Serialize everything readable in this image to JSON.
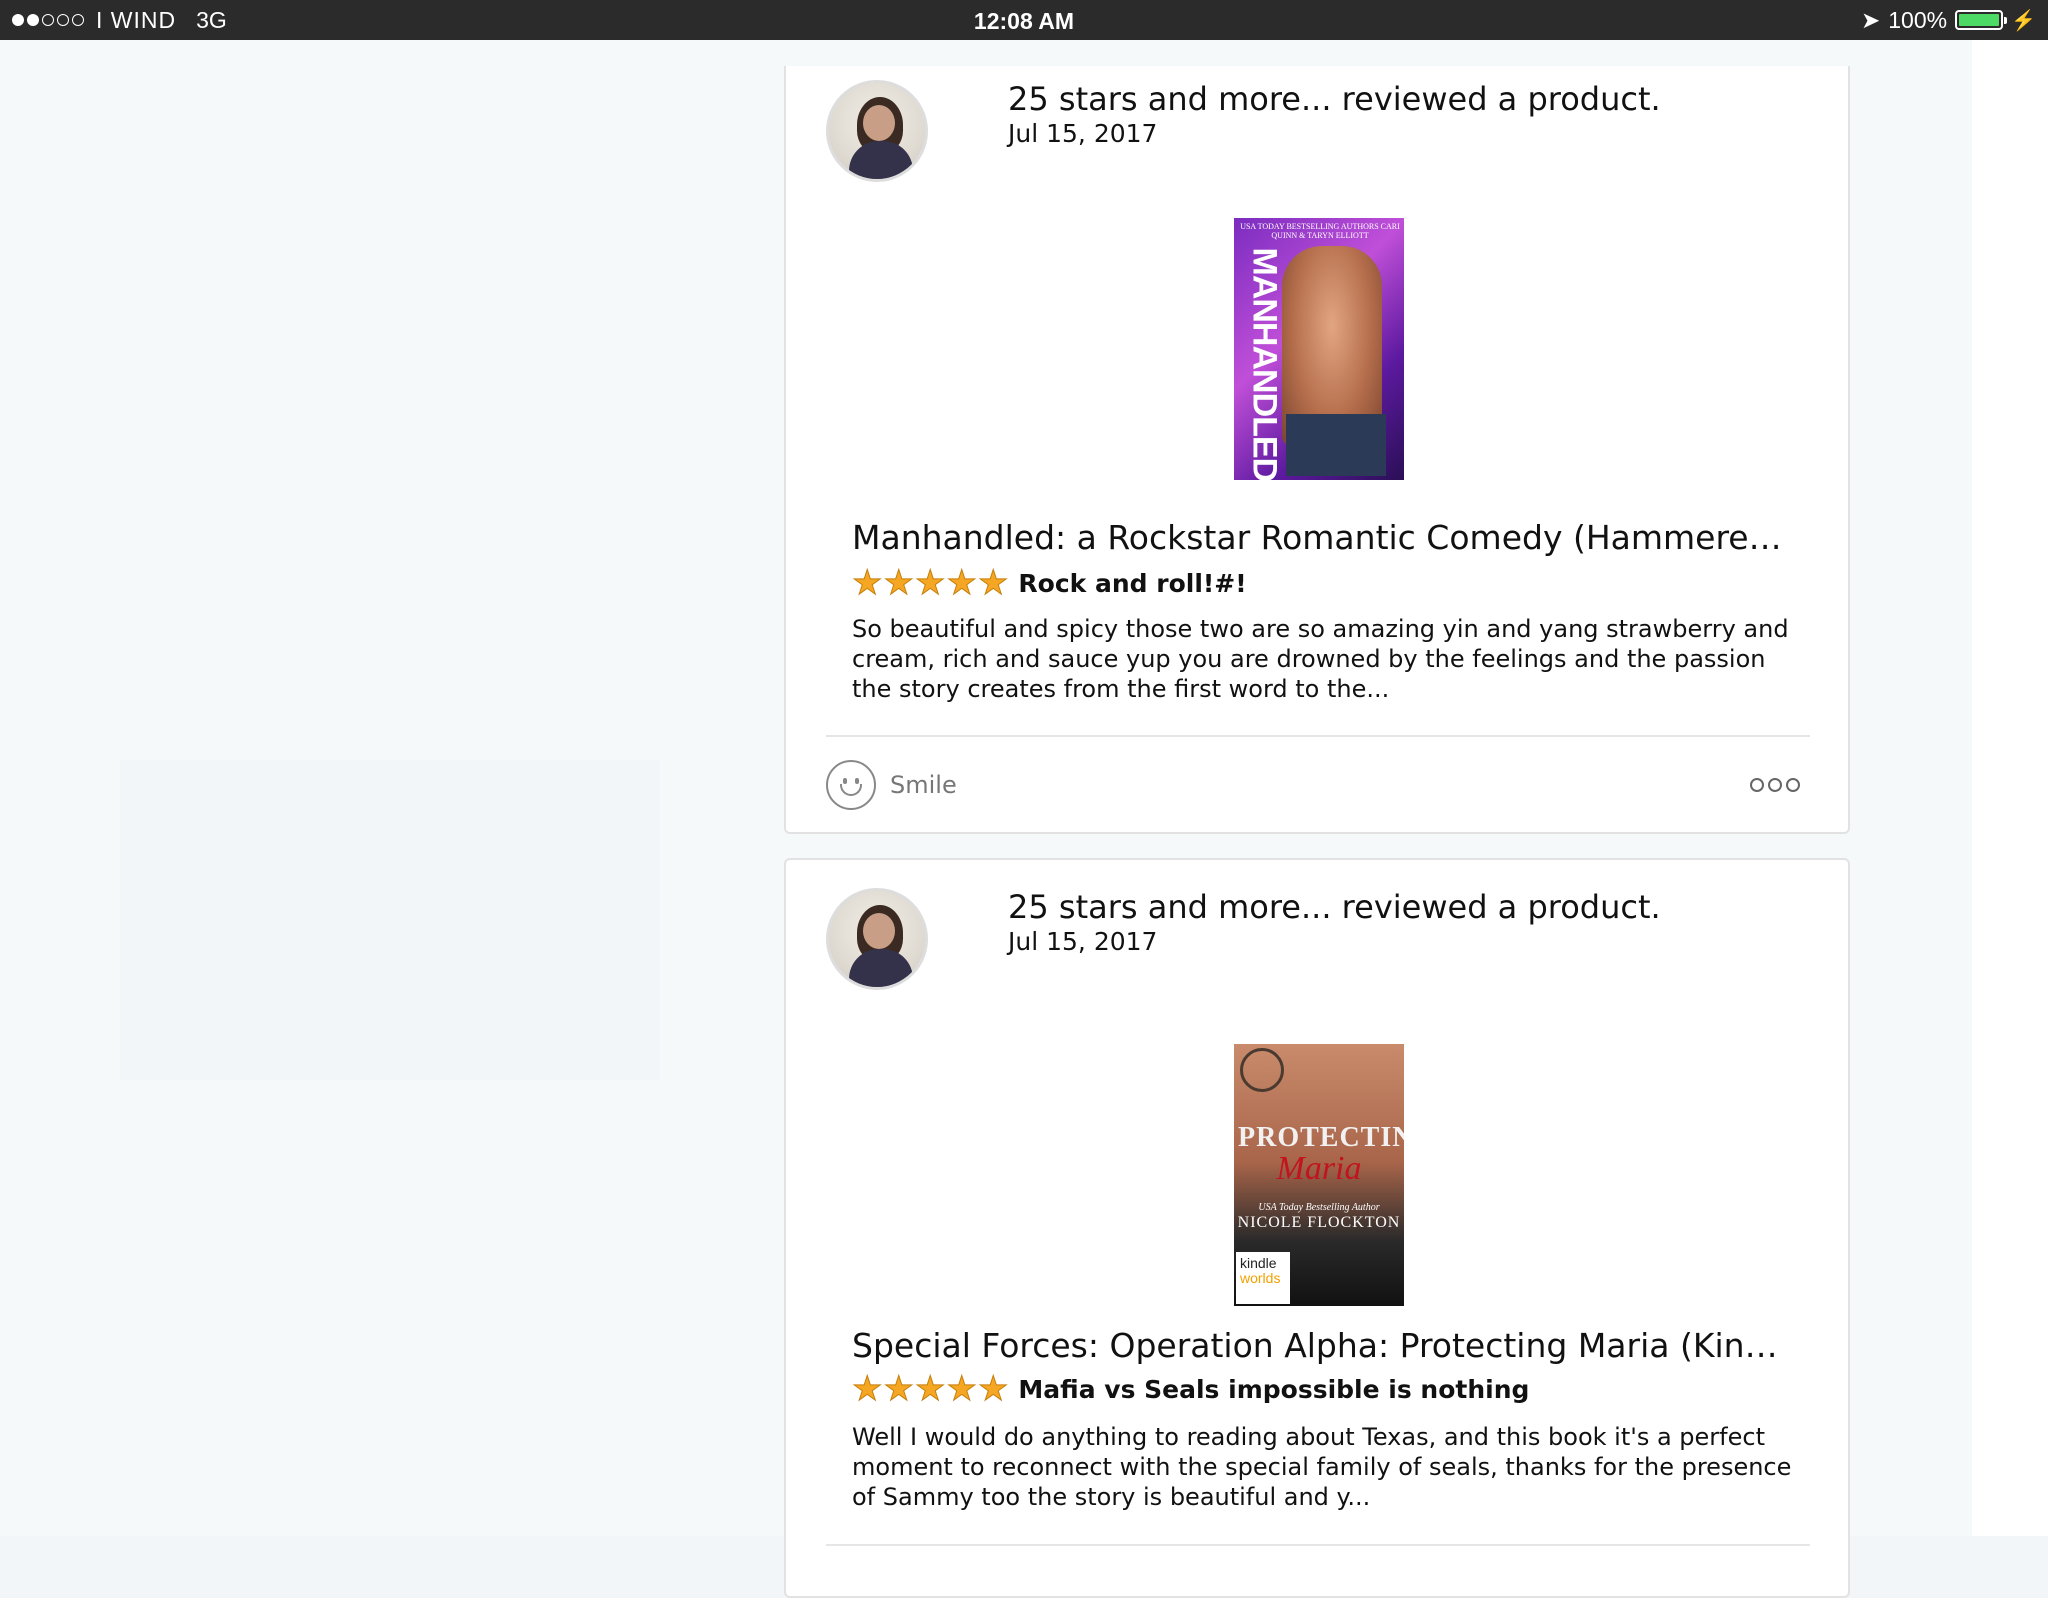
{
  "status_bar": {
    "carrier": "I WIND",
    "network": "3G",
    "time": "12:08 AM",
    "battery": "100%",
    "signal_bars_filled": 2,
    "signal_bars_total": 5
  },
  "feed": [
    {
      "headline": "25 stars and more... reviewed a product.",
      "date": "Jul 15, 2017",
      "product_title": "Manhandled: a Rockstar Romantic Comedy (Hammered B…",
      "rating": 5,
      "review_title": "Rock and roll!#!",
      "review_body": "So beautiful and spicy those two are so amazing yin and yang strawberry and cream, rich and sauce yup you are drowned by the feelings and the passion the story creates from the first word to the...",
      "cover_title": "MANHANDLED",
      "cover_authors": "USA TODAY BESTSELLING AUTHORS CARI QUINN & TARYN ELLIOTT",
      "smile_label": "Smile"
    },
    {
      "headline": "25 stars and more... reviewed a product.",
      "date": "Jul 15, 2017",
      "product_title": "Special Forces: Operation Alpha: Protecting Maria (Kindle …",
      "rating": 5,
      "review_title": "Mafia vs Seals impossible is nothing",
      "review_body": "Well I would do anything to reading about Texas, and this book it's a perfect moment to reconnect with the special family of seals, thanks for the presence of Sammy too the story is beautiful and y...",
      "cover_title_1": "PROTECTING",
      "cover_title_2": "Maria",
      "cover_tagline": "USA Today Bestselling Author",
      "cover_author": "NICOLE FLOCKTON",
      "cover_badge_1": "kindle",
      "cover_badge_2": "worlds"
    }
  ],
  "colors": {
    "star": "#f5a623",
    "battery": "#4cd964",
    "status_bar": "#2b2b2b"
  }
}
